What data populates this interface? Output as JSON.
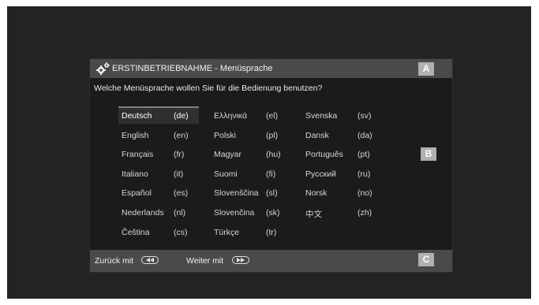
{
  "header": {
    "title": "ERSTINBETRIEBNAHME - Menüsprache",
    "icon": "gear-icon",
    "badge_a": "A"
  },
  "question": "Welche Menüsprache wollen Sie für die Bedienung benutzen?",
  "badge_b": "B",
  "languages": [
    {
      "name": "Deutsch",
      "code": "(de)",
      "selected": true
    },
    {
      "name": "English",
      "code": "(en)"
    },
    {
      "name": "Français",
      "code": "(fr)"
    },
    {
      "name": "Italiano",
      "code": "(it)"
    },
    {
      "name": "Español",
      "code": "(es)"
    },
    {
      "name": "Nederlands",
      "code": "(nl)"
    },
    {
      "name": "Čeština",
      "code": "(cs)"
    },
    {
      "name": "Ελληνικά",
      "code": "(el)"
    },
    {
      "name": "Polski",
      "code": "(pl)"
    },
    {
      "name": "Magyar",
      "code": "(hu)"
    },
    {
      "name": "Suomi",
      "code": "(fi)"
    },
    {
      "name": "Slovenščina",
      "code": "(sl)"
    },
    {
      "name": "Slovenčina",
      "code": "(sk)"
    },
    {
      "name": "Türkçe",
      "code": "(tr)"
    },
    {
      "name": "Svenska",
      "code": "(sv)"
    },
    {
      "name": "Dansk",
      "code": "(da)"
    },
    {
      "name": "Português",
      "code": "(pt)"
    },
    {
      "name": "Русский",
      "code": "(ru)"
    },
    {
      "name": "Norsk",
      "code": "(no)"
    },
    {
      "name": "中文",
      "code": "(zh)"
    }
  ],
  "footer": {
    "back_label": "Zurück mit",
    "back_icon": "rewind-icon",
    "next_label": "Weiter mit",
    "next_icon": "fast-forward-icon",
    "badge_c": "C"
  }
}
